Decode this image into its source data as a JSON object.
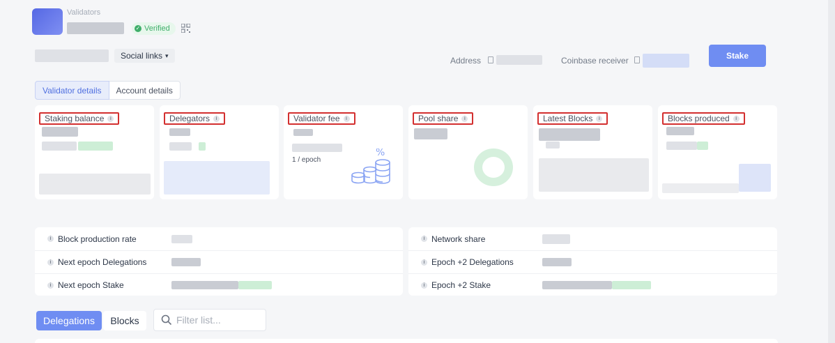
{
  "header": {
    "breadcrumb": "Validators",
    "verified_label": "Verified",
    "social_links_label": "Social links",
    "address_label": "Address",
    "coinbase_label": "Coinbase receiver",
    "stake_label": "Stake"
  },
  "tabs": [
    "Validator details",
    "Account details"
  ],
  "cards": [
    {
      "title": "Staking balance"
    },
    {
      "title": "Delegators"
    },
    {
      "title": "Validator fee",
      "sub": "1 / epoch"
    },
    {
      "title": "Pool share"
    },
    {
      "title": "Latest Blocks"
    },
    {
      "title": "Blocks produced"
    }
  ],
  "details_left": [
    "Block production rate",
    "Next epoch Delegations",
    "Next epoch Stake"
  ],
  "details_right": [
    "Network share",
    "Epoch +2 Delegations",
    "Epoch +2 Stake"
  ],
  "bottom_tabs": [
    "Delegations",
    "Blocks"
  ],
  "search_placeholder": "Filter list...",
  "colors": {
    "accent": "#6f8df2",
    "verified": "#3fae6a",
    "highlight": "#d32f2f"
  }
}
